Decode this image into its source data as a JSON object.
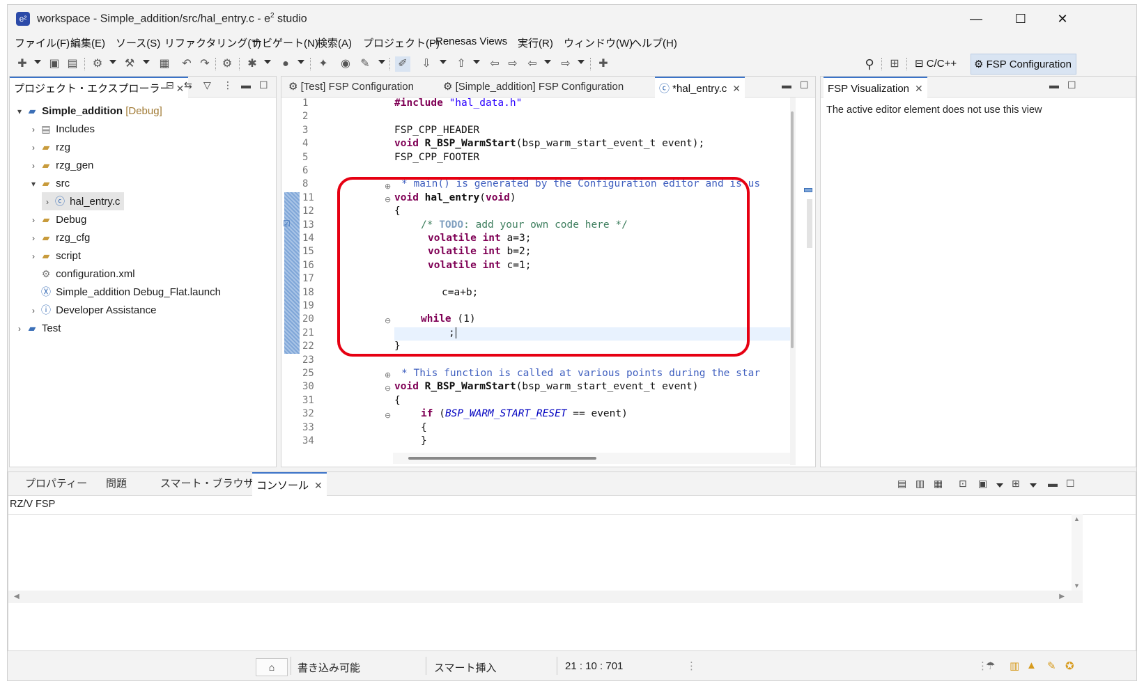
{
  "window": {
    "title_prefix": "workspace - Simple_addition/src/hal_entry.c - e",
    "title_sup": "2",
    "title_suffix": " studio",
    "minimize": "—",
    "maximize": "☐",
    "close": "✕"
  },
  "menu": [
    "ファイル(F)",
    "編集(E)",
    "ソース(S)",
    "リファクタリング(T)",
    "ナビゲート(N)",
    "検索(A)",
    "プロジェクト(P)",
    "Renesas Views",
    "実行(R)",
    "ウィンドウ(W)",
    "ヘルプ(H)"
  ],
  "perspectives": {
    "cpp": "C/C++",
    "fsp": "FSP Configuration"
  },
  "explorer": {
    "tab_label": "プロジェクト・エクスプローラー",
    "root_name": "Simple_addition",
    "root_tag": "[Debug]",
    "items": [
      "Includes",
      "rzg",
      "rzg_gen",
      "src",
      "hal_entry.c",
      "Debug",
      "rzg_cfg",
      "script",
      "configuration.xml",
      "Simple_addition Debug_Flat.launch",
      "Developer Assistance",
      "Test"
    ]
  },
  "editor": {
    "tabs": [
      "[Test] FSP Configuration",
      "[Simple_addition] FSP Configuration",
      "*hal_entry.c"
    ],
    "line_numbers": [
      "1",
      "2",
      "3",
      "4",
      "5",
      "6",
      "8",
      "11",
      "12",
      "13",
      "14",
      "15",
      "16",
      "17",
      "18",
      "19",
      "20",
      "21",
      "22",
      "23",
      "25",
      "30",
      "31",
      "32",
      "33",
      "34"
    ],
    "line_include_kw": "#include",
    "line_include_str": " \"hal_data.h\"",
    "line_cpp_header": "FSP_CPP_HEADER",
    "line_warm_decl_kw": "void ",
    "line_warm_decl_fn": "R_BSP_WarmStart",
    "line_warm_decl_rest": "(bsp_warm_start_event_t event);",
    "line_cpp_footer": "FSP_CPP_FOOTER",
    "line_main_comment": "* main() is generated by the Configuration editor and is us",
    "line_hal_kw": "void ",
    "line_hal_fn": "hal_entry",
    "line_hal_paren": "(",
    "line_hal_void": "void",
    "line_hal_close": ")",
    "brace_open": "{",
    "todo_open": "/* ",
    "todo_word": "TODO",
    "todo_rest": ": add your own code here */",
    "volatile_kw": "volatile",
    "int_kw": "int",
    "var_a": " a=3;",
    "var_b": " b=2;",
    "var_c": " c=1;",
    "sum_line": "c=a+b;",
    "while_kw": "while",
    "while_rest": " (1)",
    "semicolon": ";",
    "brace_close": "}",
    "func_comment": "* This function is called at various points during the star",
    "warm_kw": "void ",
    "warm_fn": "R_BSP_WarmStart",
    "warm_rest": "(bsp_warm_start_event_t event)",
    "if_kw": "if",
    "if_open": " (",
    "if_macro": "BSP_WARM_START_RESET",
    "if_rest": " == event)"
  },
  "fsp_view": {
    "tab_label": "FSP Visualization",
    "message": "The active editor element does not use this view"
  },
  "bottom": {
    "tabs": [
      "プロパティー",
      "問題",
      "スマート・ブラウザー",
      "コンソール"
    ],
    "console_title": "RZ/V FSP"
  },
  "status": {
    "writable": "書き込み可能",
    "insert_mode": "スマート挿入",
    "position": "21 : 10 : 701"
  }
}
